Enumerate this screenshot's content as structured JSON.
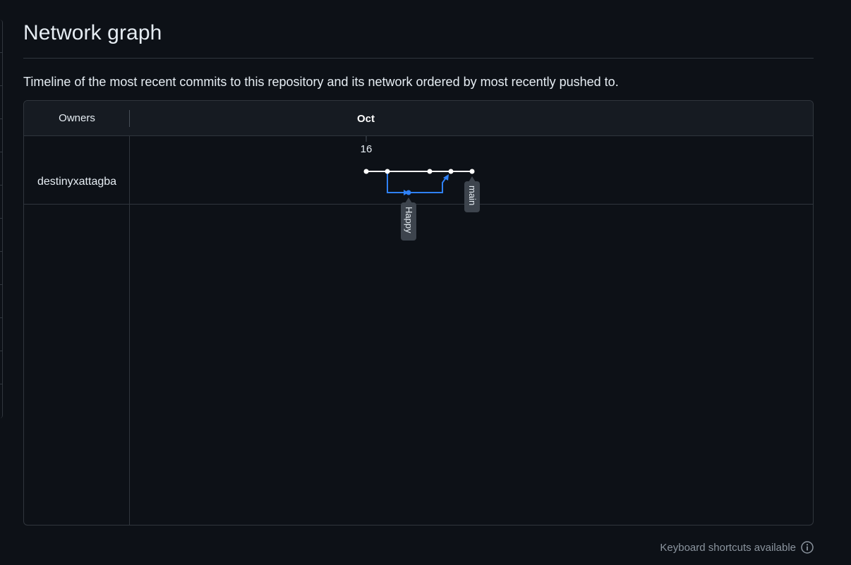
{
  "page": {
    "title": "Network graph",
    "description": "Timeline of the most recent commits to this repository and its network ordered by most recently pushed to."
  },
  "graph": {
    "owners_header": "Owners",
    "month_label": "Oct",
    "day_label": "16",
    "owners": [
      {
        "name": "destinyxattagba"
      }
    ],
    "branches": [
      {
        "label": "main",
        "color": "#ffffff"
      },
      {
        "label": "Happy",
        "color": "#2f81f7"
      }
    ],
    "commit_count_main": 5,
    "commit_count_happy": 1
  },
  "footer": {
    "shortcuts_text": "Keyboard shortcuts available",
    "icon": "info-icon"
  },
  "colors": {
    "background": "#0d1117",
    "header_background": "#161b22",
    "border": "#30363d",
    "main_branch": "#ffffff",
    "feature_branch": "#2f81f7",
    "label_badge": "#3d444d"
  }
}
